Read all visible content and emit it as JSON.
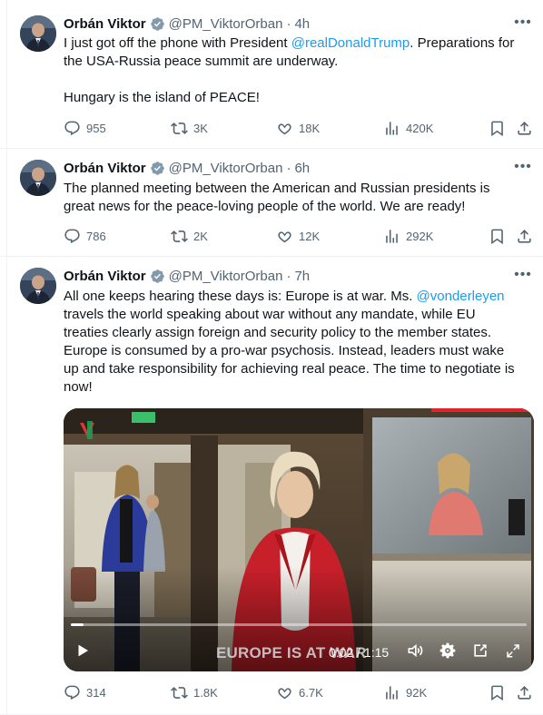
{
  "tweets": [
    {
      "author": {
        "name": "Orbán Viktor",
        "handle": "@PM_ViktorOrban",
        "verified": true
      },
      "time": "4h",
      "lines": [
        {
          "parts": [
            "I just got off the phone with President ",
            "@realDonaldTrump",
            ". Preparations for"
          ]
        },
        {
          "parts": [
            "the USA-Russia peace summit are underway."
          ]
        },
        {
          "parts": [
            ""
          ]
        },
        {
          "parts": [
            "Hungary is the island of PEACE!"
          ]
        }
      ],
      "stats": {
        "replies": "955",
        "reposts": "3K",
        "likes": "18K",
        "views": "420K"
      }
    },
    {
      "author": {
        "name": "Orbán Viktor",
        "handle": "@PM_ViktorOrban",
        "verified": true
      },
      "time": "6h",
      "lines": [
        {
          "parts": [
            "The planned meeting between the American and Russian presidents is"
          ]
        },
        {
          "parts": [
            "great news for the peace-loving people of the world. We are ready!"
          ]
        }
      ],
      "stats": {
        "replies": "786",
        "reposts": "2K",
        "likes": "12K",
        "views": "292K"
      }
    },
    {
      "author": {
        "name": "Orbán Viktor",
        "handle": "@PM_ViktorOrban",
        "verified": true
      },
      "time": "7h",
      "lines": [
        {
          "parts": [
            "All one keeps hearing these days is: Europe is at war. Ms. ",
            "@vonderleyen"
          ]
        },
        {
          "parts": [
            "travels the world speaking about war without any mandate, while EU"
          ]
        },
        {
          "parts": [
            "treaties clearly assign foreign and security policy to the member states."
          ]
        },
        {
          "parts": [
            "Europe is consumed by a pro-war psychosis. Instead, leaders must wake"
          ]
        },
        {
          "parts": [
            "up and take responsibility for achieving real peace. The time to negotiate is"
          ]
        },
        {
          "parts": [
            "now!"
          ]
        }
      ],
      "video": {
        "caption": "EUROPE IS AT WAR",
        "time": "0:02 / 1:15",
        "progress": 0.027
      },
      "stats": {
        "replies": "314",
        "reposts": "1.8K",
        "likes": "6.7K",
        "views": "92K"
      }
    }
  ],
  "colors": {
    "link": "#1d9bf0",
    "verified": "#829aab",
    "secondary_text": "#536471",
    "text": "#0f1419"
  },
  "icons": [
    "verified-badge-icon",
    "more-icon",
    "reply-icon",
    "repost-icon",
    "like-icon",
    "views-icon",
    "bookmark-icon",
    "share-icon",
    "play-icon",
    "volume-icon",
    "settings-icon",
    "pip-icon",
    "fullscreen-icon"
  ]
}
